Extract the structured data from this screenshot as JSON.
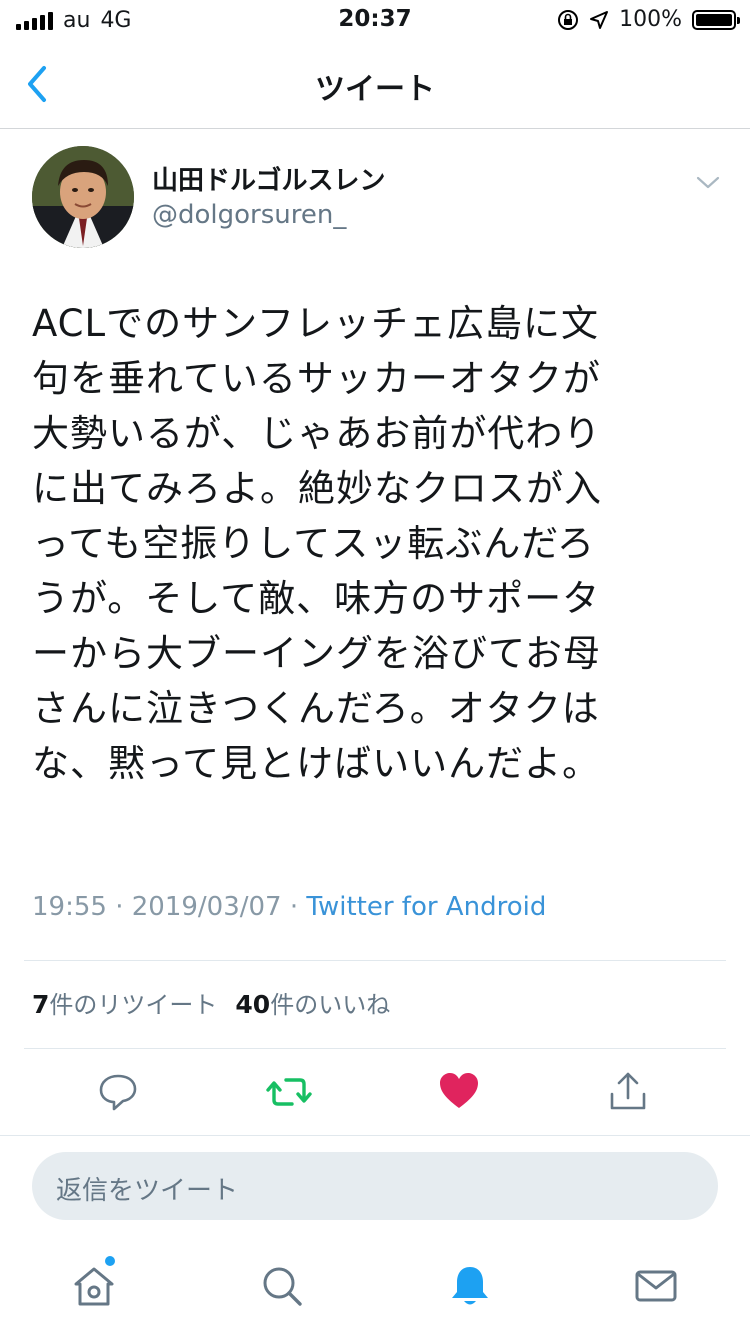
{
  "status_bar": {
    "carrier": "au",
    "network": "4G",
    "time": "20:37",
    "battery": "100%"
  },
  "nav": {
    "title": "ツイート",
    "back_icon": "chevron-left-icon"
  },
  "tweet": {
    "display_name": "山田ドルゴルスレン",
    "handle": "@dolgorsuren_",
    "text": "ACLでのサンフレッチェ広島に文\n句を垂れているサッカーオタクが\n大勢いるが、じゃあお前が代わり\nに出てみろよ。絶妙なクロスが入\nっても空振りしてスッ転ぶんだろ\nうが。そして敵、味方のサポータ\nーから大ブーイングを浴びてお母\nさんに泣きつくんだろ。オタクは\nな、黙って見とけばいいんだよ。",
    "time": "19:55",
    "date": "2019/03/07",
    "separator": "·",
    "source": "Twitter for Android"
  },
  "stats": {
    "retweet_count": "7",
    "retweet_label": "件のリツイート",
    "like_count": "40",
    "like_label": "件のいいね"
  },
  "actions": {
    "reply_icon": "reply-icon",
    "retweet_icon": "retweet-icon",
    "like_icon": "heart-icon",
    "share_icon": "share-icon"
  },
  "reply": {
    "placeholder": "返信をツイート"
  },
  "tab_bar": {
    "items": [
      "home-icon",
      "search-icon",
      "bell-icon",
      "mail-icon"
    ]
  },
  "colors": {
    "accent": "#1da1f2",
    "retweet_green": "#17bf63",
    "like_red": "#e0245e",
    "secondary_text": "#657786"
  }
}
